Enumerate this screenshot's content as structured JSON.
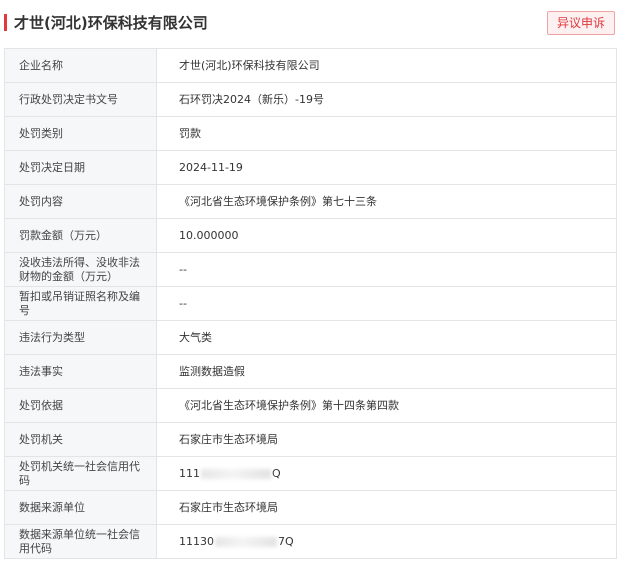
{
  "header": {
    "company_title": "才世(河北)环保科技有限公司",
    "objection_button": "异议申诉"
  },
  "rows": [
    {
      "label": "企业名称",
      "value": "才世(河北)环保科技有限公司"
    },
    {
      "label": "行政处罚决定书文号",
      "value": "石环罚决2024（新乐）-19号"
    },
    {
      "label": "处罚类别",
      "value": "罚款"
    },
    {
      "label": "处罚决定日期",
      "value": "2024-11-19"
    },
    {
      "label": "处罚内容",
      "value": "《河北省生态环境保护条例》第七十三条"
    },
    {
      "label": "罚款金额（万元）",
      "value": "10.000000"
    },
    {
      "label": "没收违法所得、没收非法财物的金额（万元）",
      "value": "--"
    },
    {
      "label": "暂扣或吊销证照名称及编号",
      "value": "--"
    },
    {
      "label": "违法行为类型",
      "value": "大气类"
    },
    {
      "label": "违法事实",
      "value": "监测数据造假"
    },
    {
      "label": "处罚依据",
      "value": "《河北省生态环境保护条例》第十四条第四款"
    },
    {
      "label": "处罚机关",
      "value": "石家庄市生态环境局"
    },
    {
      "label": "处罚机关统一社会信用代码",
      "value_prefix": "111",
      "value_suffix": "Q"
    },
    {
      "label": "数据来源单位",
      "value": "石家庄市生态环境局"
    },
    {
      "label": "数据来源单位统一社会信用代码",
      "value_prefix": "11130",
      "value_suffix": "7Q"
    }
  ]
}
